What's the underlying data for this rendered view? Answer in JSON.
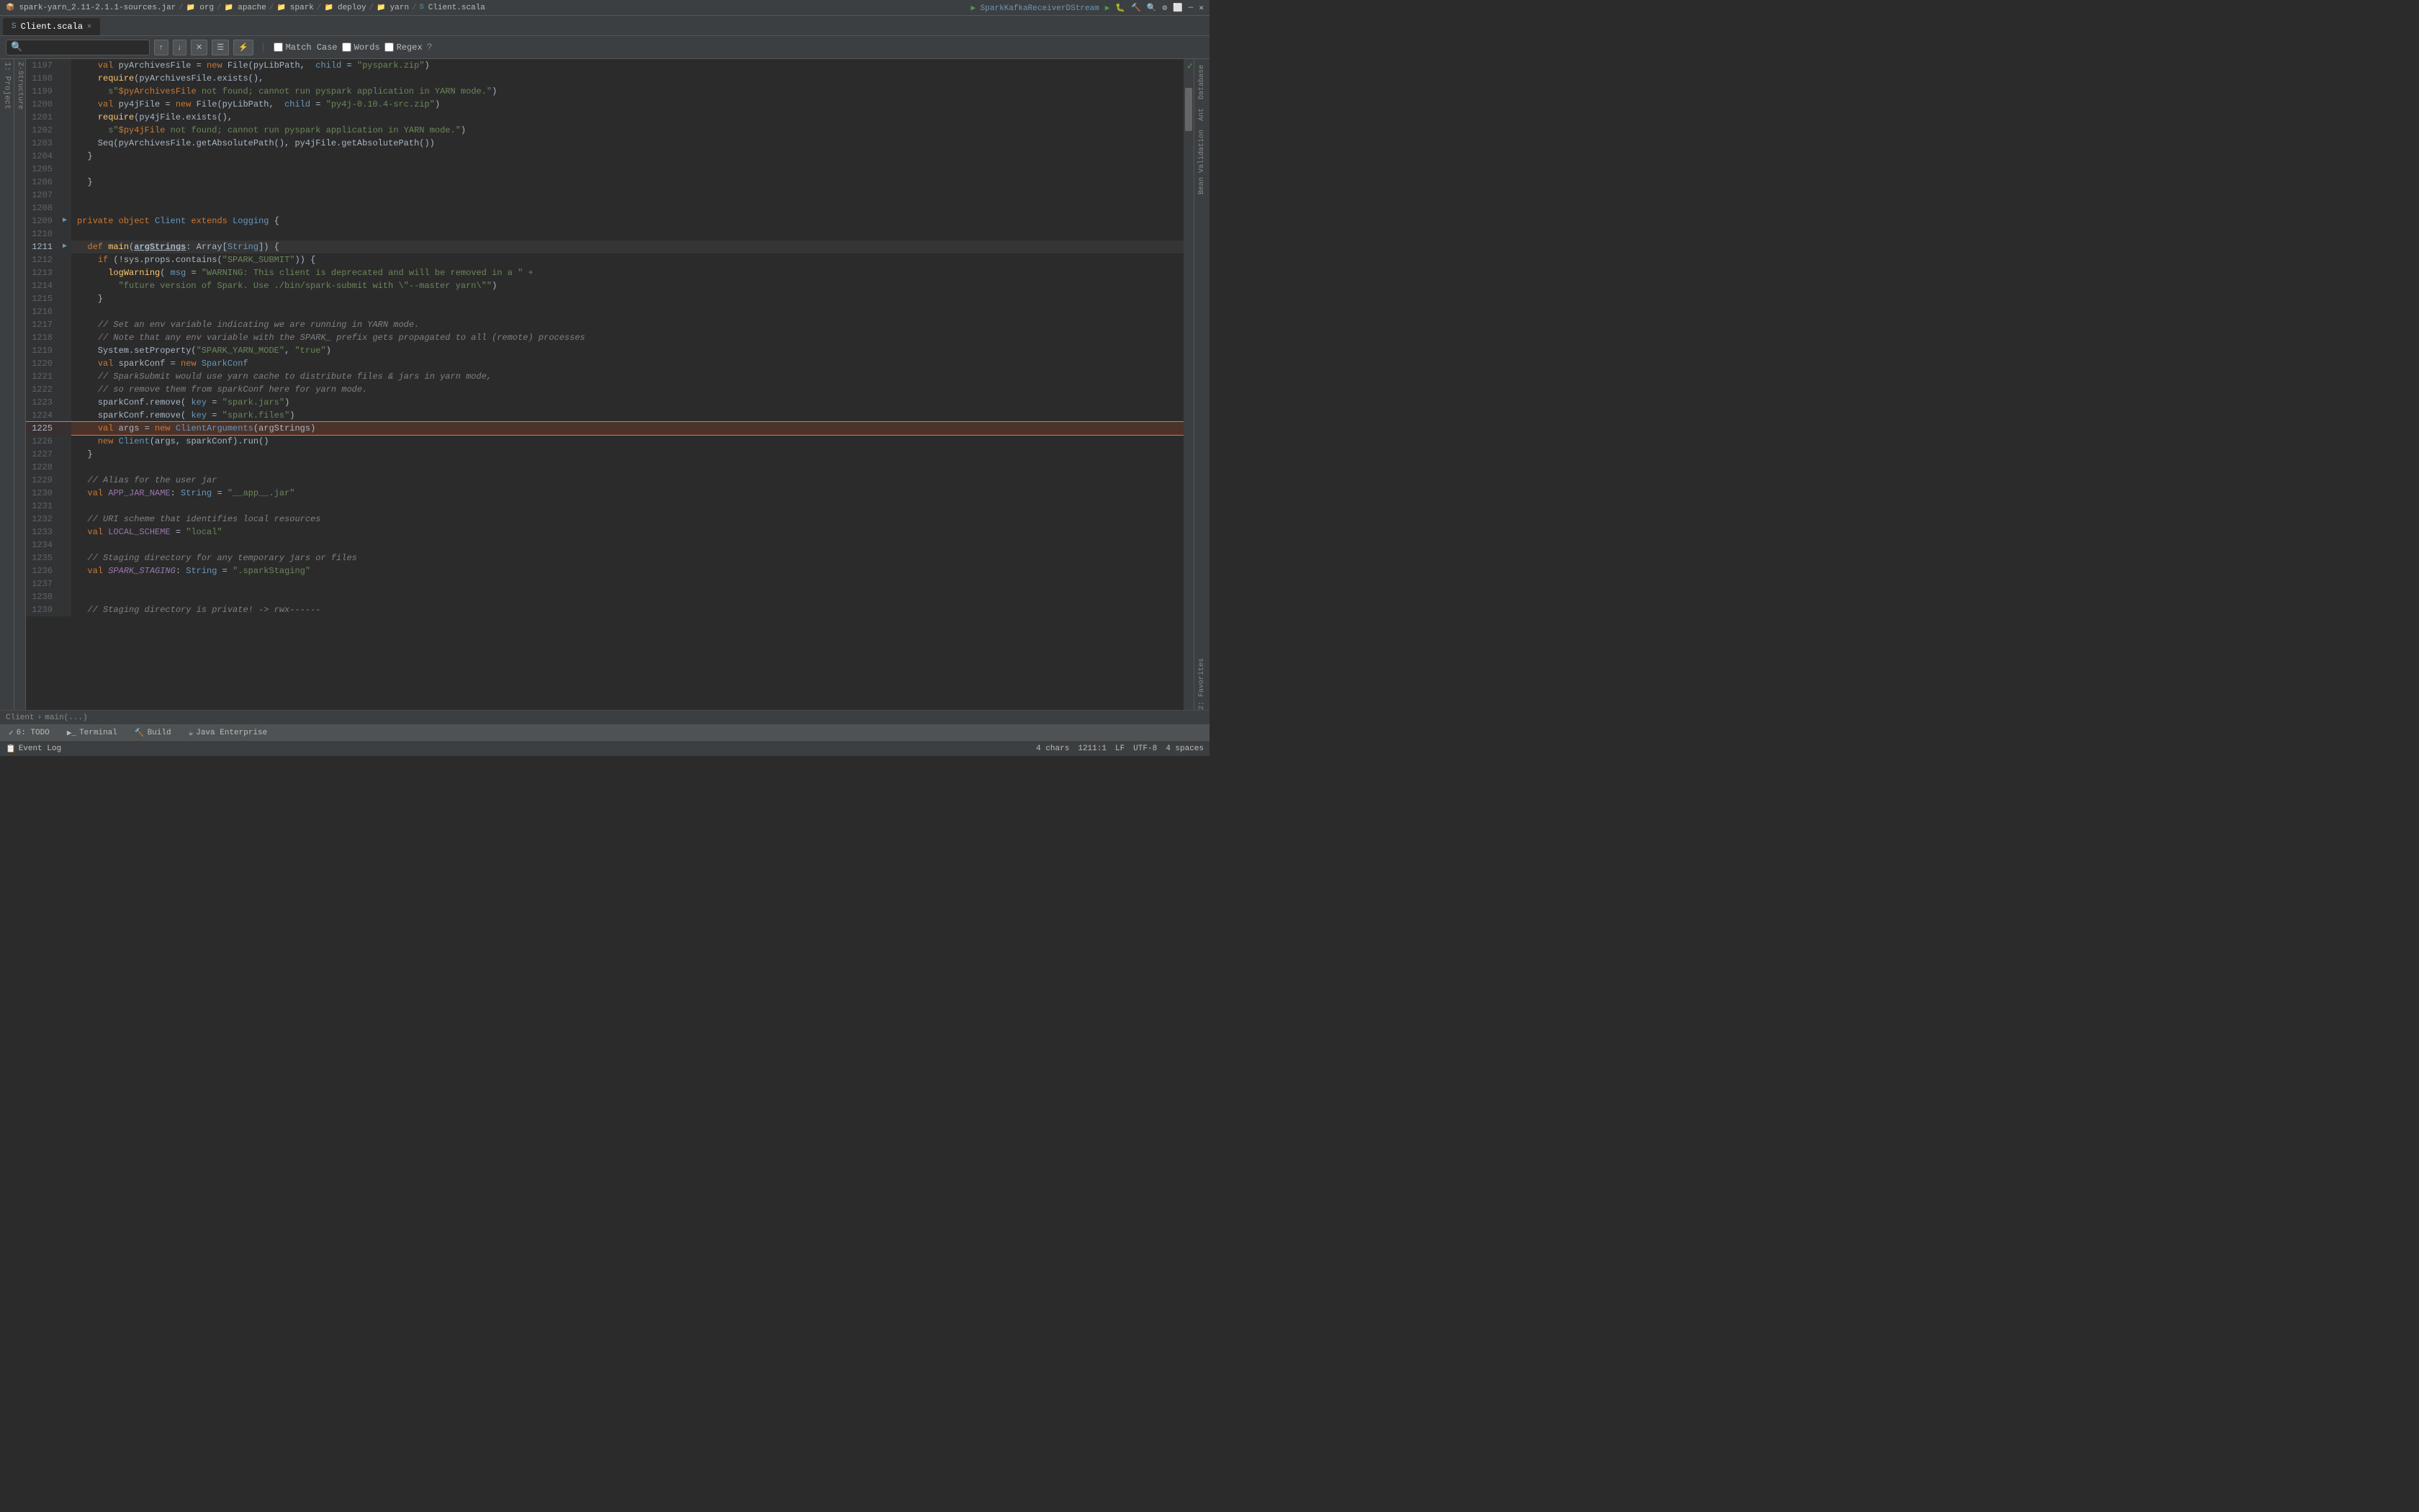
{
  "titlebar": {
    "filename": "spark-yarn_2.11-2.1.1-sources.jar",
    "breadcrumb": [
      "org",
      "apache",
      "spark",
      "deploy",
      "yarn"
    ],
    "activeFile": "Client.scala",
    "runConfig": "SparkKafkaReceiverDStream"
  },
  "tab": {
    "label": "Client.scala"
  },
  "search": {
    "placeholder": "",
    "matchCase": "Match Case",
    "words": "Words",
    "regex": "Regex"
  },
  "lines": [
    {
      "num": 1197,
      "fold": false,
      "gutter": "",
      "content": "    val pyArchivesFile = new File(pyLibPath,  child = \"pyspark.zip\")",
      "highlight": false
    },
    {
      "num": 1198,
      "fold": false,
      "gutter": "",
      "content": "    require(pyArchivesFile.exists(),",
      "highlight": false
    },
    {
      "num": 1199,
      "fold": false,
      "gutter": "",
      "content": "      s\"$pyArchivesFile not found; cannot run pyspark application in YARN mode.\")",
      "highlight": false
    },
    {
      "num": 1200,
      "fold": false,
      "gutter": "",
      "content": "    val py4jFile = new File(pyLibPath,  child = \"py4j-0.10.4-src.zip\")",
      "highlight": false
    },
    {
      "num": 1201,
      "fold": false,
      "gutter": "",
      "content": "    require(py4jFile.exists(),",
      "highlight": false
    },
    {
      "num": 1202,
      "fold": false,
      "gutter": "",
      "content": "      s\"$py4jFile not found; cannot run pyspark application in YARN mode.\")",
      "highlight": false
    },
    {
      "num": 1203,
      "fold": false,
      "gutter": "",
      "content": "    Seq(pyArchivesFile.getAbsolutePath(), py4jFile.getAbsolutePath())",
      "highlight": false
    },
    {
      "num": 1204,
      "fold": false,
      "gutter": "",
      "content": "  }",
      "highlight": false
    },
    {
      "num": 1205,
      "fold": false,
      "gutter": "",
      "content": "",
      "highlight": false
    },
    {
      "num": 1206,
      "fold": false,
      "gutter": "",
      "content": "  }",
      "highlight": false
    },
    {
      "num": 1207,
      "fold": false,
      "gutter": "",
      "content": "",
      "highlight": false
    },
    {
      "num": 1208,
      "fold": false,
      "gutter": "",
      "content": "",
      "highlight": false
    },
    {
      "num": 1209,
      "fold": true,
      "gutter": "▶",
      "content": "private object Client extends Logging {",
      "highlight": false
    },
    {
      "num": 1210,
      "fold": false,
      "gutter": "",
      "content": "",
      "highlight": false
    },
    {
      "num": 1211,
      "fold": true,
      "gutter": "▶",
      "content": "  def main(argStrings: Array[String]) {",
      "highlight": false
    },
    {
      "num": 1212,
      "fold": false,
      "gutter": "",
      "content": "    if (!sys.props.contains(\"SPARK_SUBMIT\")) {",
      "highlight": false
    },
    {
      "num": 1213,
      "fold": false,
      "gutter": "",
      "content": "      logWarning( msg = \"WARNING: This client is deprecated and will be removed in a \" +",
      "highlight": false
    },
    {
      "num": 1214,
      "fold": false,
      "gutter": "",
      "content": "        \"future version of Spark. Use ./bin/spark-submit with \\\"--master yarn\\\"\")",
      "highlight": false
    },
    {
      "num": 1215,
      "fold": false,
      "gutter": "",
      "content": "    }",
      "highlight": false
    },
    {
      "num": 1216,
      "fold": false,
      "gutter": "",
      "content": "",
      "highlight": false
    },
    {
      "num": 1217,
      "fold": false,
      "gutter": "",
      "content": "    // Set an env variable indicating we are running in YARN mode.",
      "highlight": false
    },
    {
      "num": 1218,
      "fold": false,
      "gutter": "",
      "content": "    // Note that any env variable with the SPARK_ prefix gets propagated to all (remote) processes",
      "highlight": false
    },
    {
      "num": 1219,
      "fold": false,
      "gutter": "",
      "content": "    System.setProperty(\"SPARK_YARN_MODE\", \"true\")",
      "highlight": false
    },
    {
      "num": 1220,
      "fold": false,
      "gutter": "",
      "content": "    val sparkConf = new SparkConf",
      "highlight": false
    },
    {
      "num": 1221,
      "fold": false,
      "gutter": "",
      "content": "    // SparkSubmit would use yarn cache to distribute files & jars in yarn mode,",
      "highlight": false
    },
    {
      "num": 1222,
      "fold": false,
      "gutter": "",
      "content": "    // so remove them from sparkConf here for yarn mode.",
      "highlight": false
    },
    {
      "num": 1223,
      "fold": false,
      "gutter": "",
      "content": "    sparkConf.remove( key = \"spark.jars\")",
      "highlight": false
    },
    {
      "num": 1224,
      "fold": false,
      "gutter": "",
      "content": "    sparkConf.remove( key = \"spark.files\")",
      "highlight": false
    },
    {
      "num": 1225,
      "fold": false,
      "gutter": "",
      "content": "    val args = new ClientArguments(argStrings)",
      "highlight": true
    },
    {
      "num": 1226,
      "fold": false,
      "gutter": "",
      "content": "    new Client(args, sparkConf).run()",
      "highlight": false
    },
    {
      "num": 1227,
      "fold": false,
      "gutter": "",
      "content": "  }",
      "highlight": false
    },
    {
      "num": 1228,
      "fold": false,
      "gutter": "",
      "content": "",
      "highlight": false
    },
    {
      "num": 1229,
      "fold": false,
      "gutter": "",
      "content": "  // Alias for the user jar",
      "highlight": false
    },
    {
      "num": 1230,
      "fold": false,
      "gutter": "",
      "content": "  val APP_JAR_NAME: String = \"__app__.jar\"",
      "highlight": false
    },
    {
      "num": 1231,
      "fold": false,
      "gutter": "",
      "content": "",
      "highlight": false
    },
    {
      "num": 1232,
      "fold": false,
      "gutter": "",
      "content": "  // URI scheme that identifies local resources",
      "highlight": false
    },
    {
      "num": 1233,
      "fold": false,
      "gutter": "",
      "content": "  val LOCAL_SCHEME = \"local\"",
      "highlight": false
    },
    {
      "num": 1234,
      "fold": false,
      "gutter": "",
      "content": "",
      "highlight": false
    },
    {
      "num": 1235,
      "fold": false,
      "gutter": "",
      "content": "  // Staging directory for any temporary jars or files",
      "highlight": false
    },
    {
      "num": 1236,
      "fold": false,
      "gutter": "",
      "content": "  val SPARK_STAGING: String = \".sparkStaging\"",
      "highlight": false
    },
    {
      "num": 1237,
      "fold": false,
      "gutter": "",
      "content": "",
      "highlight": false
    },
    {
      "num": 1238,
      "fold": false,
      "gutter": "",
      "content": "",
      "highlight": false
    },
    {
      "num": 1239,
      "fold": false,
      "gutter": "",
      "content": "  // Staging directory is private! -> rwx------",
      "highlight": false
    }
  ],
  "statusbar": {
    "todo": "6: TODO",
    "terminal": "Terminal",
    "build": "Build",
    "javaEnterprise": "Java Enterprise",
    "chars": "4 chars",
    "line": "1211",
    "col": "1",
    "lf": "LF",
    "encoding": "UTF-8",
    "indent": "4 spaces",
    "eventLog": "Event Log"
  },
  "breadcrumbBottom": {
    "path": "Client",
    "method": "main(...)"
  },
  "rightPanel": {
    "labels": [
      "Database",
      "Ant",
      "Bean Validation",
      "2: Favorites"
    ]
  }
}
